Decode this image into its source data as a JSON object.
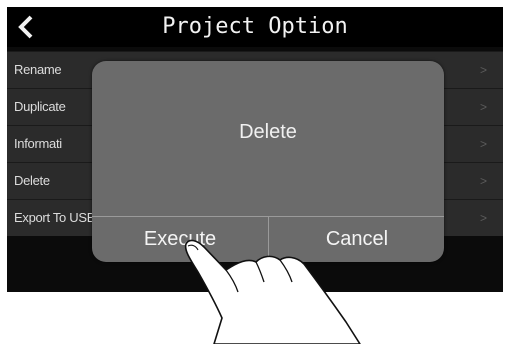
{
  "header": {
    "title": "Project Option",
    "back_icon": "chevron-left-icon"
  },
  "menu": {
    "items": [
      {
        "label": "Rename",
        "chevron": ">"
      },
      {
        "label": "Duplicate",
        "chevron": ">"
      },
      {
        "label": "Informati",
        "chevron": ">"
      },
      {
        "label": "Delete",
        "chevron": ">"
      },
      {
        "label": "Export To USB Memory",
        "chevron": ">"
      }
    ]
  },
  "dialog": {
    "title": "Delete",
    "execute_label": "Execute",
    "cancel_label": "Cancel"
  },
  "overlay": {
    "icon": "pointing-hand-icon"
  },
  "colors": {
    "screen_bg": "#0b0b0b",
    "row_bg": "#2b2b2b",
    "dialog_bg": "#6b6b6b",
    "text": "#f0f0f0"
  }
}
